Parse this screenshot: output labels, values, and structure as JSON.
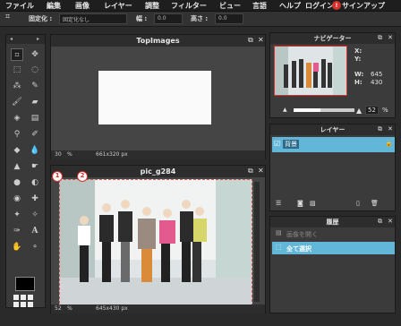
{
  "menubar": {
    "items": [
      "ファイル",
      "編集",
      "画像",
      "レイヤー",
      "調整",
      "フィルター",
      "ビュー",
      "言語",
      "ヘルプ",
      "ログイン",
      "サインアップ"
    ]
  },
  "options": {
    "fixed_label": "固定化 :",
    "fixed_value": "固定化なし",
    "width_label": "幅 :",
    "width_value": "0.0",
    "height_label": "高さ :",
    "height_value": "0.0"
  },
  "doc_top": {
    "title": "TopImages",
    "zoom": "30",
    "zoom_unit": "%",
    "size": "661x320 px"
  },
  "doc_main": {
    "title": "pic_g284",
    "zoom": "52",
    "zoom_unit": "%",
    "size": "645x430 px"
  },
  "navigator": {
    "title": "ナビゲーター",
    "x_label": "X:",
    "y_label": "Y:",
    "w_label": "W:",
    "w_value": "645",
    "h_label": "H:",
    "h_value": "430",
    "zoom": "52",
    "zoom_unit": "%"
  },
  "layers": {
    "title": "レイヤー",
    "items": [
      {
        "name": "背景"
      }
    ]
  },
  "history": {
    "title": "履歴",
    "items": [
      "画像を開く",
      "全て選択"
    ]
  },
  "markers": [
    "1",
    "2"
  ],
  "colors": {
    "accent": "#62b6d8",
    "marker": "#d8312b",
    "background": "#2a2a2a"
  }
}
